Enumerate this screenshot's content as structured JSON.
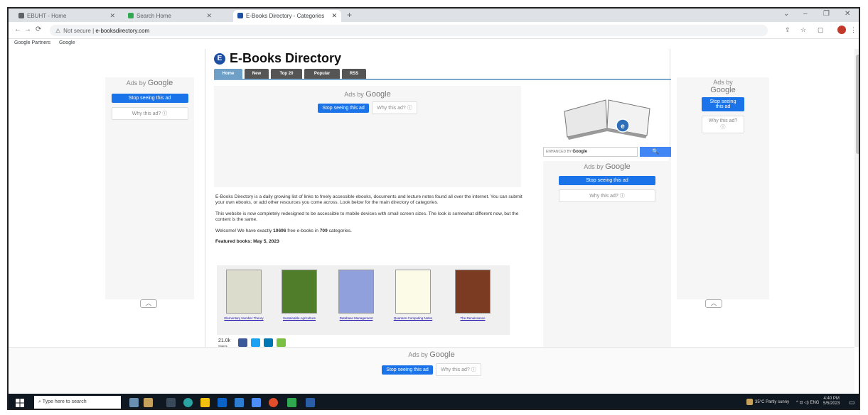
{
  "browser": {
    "tabs": [
      {
        "label": "EBUHT - Home",
        "color": "#5f6368"
      },
      {
        "label": "Search Home",
        "color": "#34a853"
      },
      {
        "label": "E-Books Directory - Categories",
        "color": "#1e4fa3"
      }
    ],
    "new_tab": "+",
    "window_controls": [
      "⌄",
      "–",
      "❐",
      "✕"
    ],
    "nav": {
      "back": "←",
      "forward": "→",
      "reload": "⟳"
    },
    "address": {
      "security": "Not secure",
      "separator": "|",
      "url": "e-booksdirectory.com"
    },
    "bookmarks": [
      "Google Partners",
      "Google"
    ]
  },
  "site": {
    "logo_letter": "E",
    "title": "E-Books Directory",
    "nav_tabs": [
      "Home",
      "New",
      "Top 20",
      "Popular",
      "RSS"
    ],
    "intro": [
      "E-Books Directory is a daily growing list of links to freely accessible ebooks, documents and lecture notes found all over the internet. You can submit your own ebooks, or add other resources you come across. Look below for the main directory of categories.",
      "This website is now completely redesigned to be accessible to mobile devices with small screen sizes. The look is somewhat different now, but the content is the same."
    ],
    "welcome": {
      "prefix": "Welcome! We have exactly ",
      "count": "10696",
      "middle": " free e-books in ",
      "categories": "709",
      "suffix": " categories."
    },
    "featured_heading": "Featured books: May 5, 2023",
    "featured_books": [
      {
        "title": "Elementary Number Theory",
        "color": "#dcdccc"
      },
      {
        "title": "Sustainable Agriculture",
        "color": "#4f7d2a"
      },
      {
        "title": "Database Management",
        "color": "#8fa0dc"
      },
      {
        "title": "Quantum Computing Notes",
        "color": "#fbfbe8"
      },
      {
        "title": "The Renaissance",
        "color": "#7a3b22"
      }
    ],
    "share": {
      "count": "21.0k",
      "label": "Shares"
    },
    "search": {
      "powered_by": "ENHANCED BY",
      "brand": "Google",
      "button_icon": "🔍"
    }
  },
  "ads": {
    "ads_by": "Ads by",
    "google": "Google",
    "stop_label": "Stop seeing this ad",
    "why_label": "Why this ad? ⓘ",
    "collapse": "︿"
  },
  "taskbar": {
    "search_placeholder": "Type here to search",
    "weather": "35°C Partly sunny",
    "time": "4:40 PM",
    "date": "5/5/2023"
  }
}
